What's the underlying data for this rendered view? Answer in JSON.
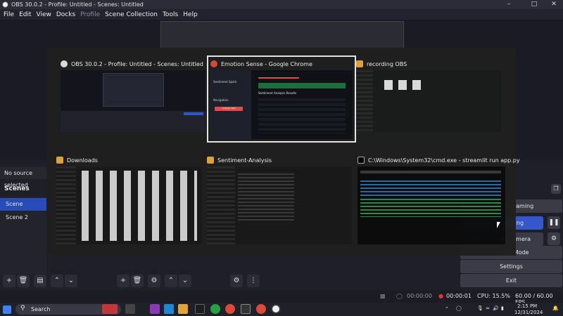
{
  "window": {
    "title": "OBS 30.0.2 - Profile: Untitled - Scenes: Untitled"
  },
  "menu": [
    "File",
    "Edit",
    "View",
    "Docks",
    "Profile",
    "Scene Collection",
    "Tools",
    "Help"
  ],
  "sources": {
    "empty_text": "No source selected"
  },
  "scenes": {
    "header": "Scenes",
    "items": [
      "Scene",
      "Scene 2"
    ],
    "selected": 0
  },
  "controls": {
    "streaming": "Start Streaming",
    "recording": "Start Recording",
    "virtual_camera": "Start Virtual Camera",
    "studio_mode": "Studio Mode",
    "settings": "Settings",
    "exit": "Exit"
  },
  "status": {
    "stream_time": "00:00:00",
    "rec_time": "00:00:01",
    "cpu": "CPU: 15.5%",
    "fps": "60.00 / 60.00 FPS"
  },
  "taskbar": {
    "search_placeholder": "Search",
    "time": "2:15 PM",
    "date": "12/31/2024"
  },
  "switcher": {
    "windows": [
      {
        "title": "OBS 30.0.2 - Profile: Untitled - Scenes: Untitled",
        "icon": "obs-icon"
      },
      {
        "title": "Emotion Sense - Google Chrome",
        "icon": "chrome-icon",
        "selected": true
      },
      {
        "title": "recording OBS",
        "icon": "folder-icon"
      },
      {
        "title": "Downloads",
        "icon": "folder-icon"
      },
      {
        "title": "Sentiment-Analysis",
        "icon": "folder-icon"
      },
      {
        "title": "C:\\Windows\\System32\\cmd.exe - streamlit  run app.py",
        "icon": "cmd-icon"
      }
    ],
    "chrome_preview": {
      "sidebar_title": "Sentiment Spark",
      "nav_label": "Navigation",
      "nav_button": "Analyze Text",
      "results_title": "Sentiment Analysis Results"
    }
  }
}
